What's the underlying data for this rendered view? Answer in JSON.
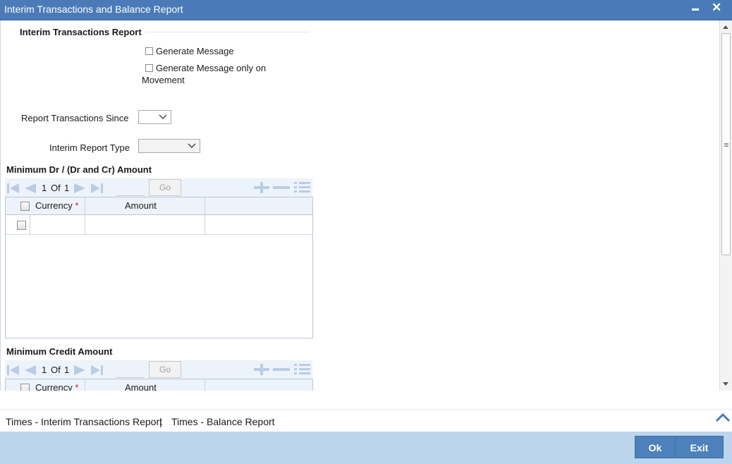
{
  "window": {
    "title": "Interim Transactions and Balance Report"
  },
  "interim_section": {
    "title": "Interim Transactions Report",
    "generate_message_label": "Generate Message",
    "generate_on_movement_label_line1": "Generate Message only on",
    "generate_on_movement_label_line2": "Movement",
    "report_since_label": "Report Transactions Since",
    "report_since_value": "",
    "report_type_label": "Interim Report Type",
    "report_type_value": ""
  },
  "min_dr_grid": {
    "title": "Minimum Dr / (Dr and Cr) Amount",
    "page_current": "1",
    "page_of": "Of",
    "page_total": "1",
    "go_label": "Go",
    "columns": [
      "Currency",
      "Amount"
    ],
    "required_marker": "*"
  },
  "min_cr_grid": {
    "title": "Minimum Credit Amount",
    "page_current": "1",
    "page_of": "Of",
    "page_total": "1",
    "go_label": "Go",
    "columns": [
      "Currency",
      "Amount"
    ],
    "required_marker": "*"
  },
  "links": {
    "interim_times": "Times - Interim Transactions Report",
    "separator": "|",
    "balance_times": "Times - Balance Report"
  },
  "buttons": {
    "ok": "Ok",
    "exit": "Exit"
  },
  "colors": {
    "title_bar": "#4a7bb8",
    "footer": "#bcd5ec",
    "button": "#4d81bb",
    "required": "#cc1f1f"
  }
}
